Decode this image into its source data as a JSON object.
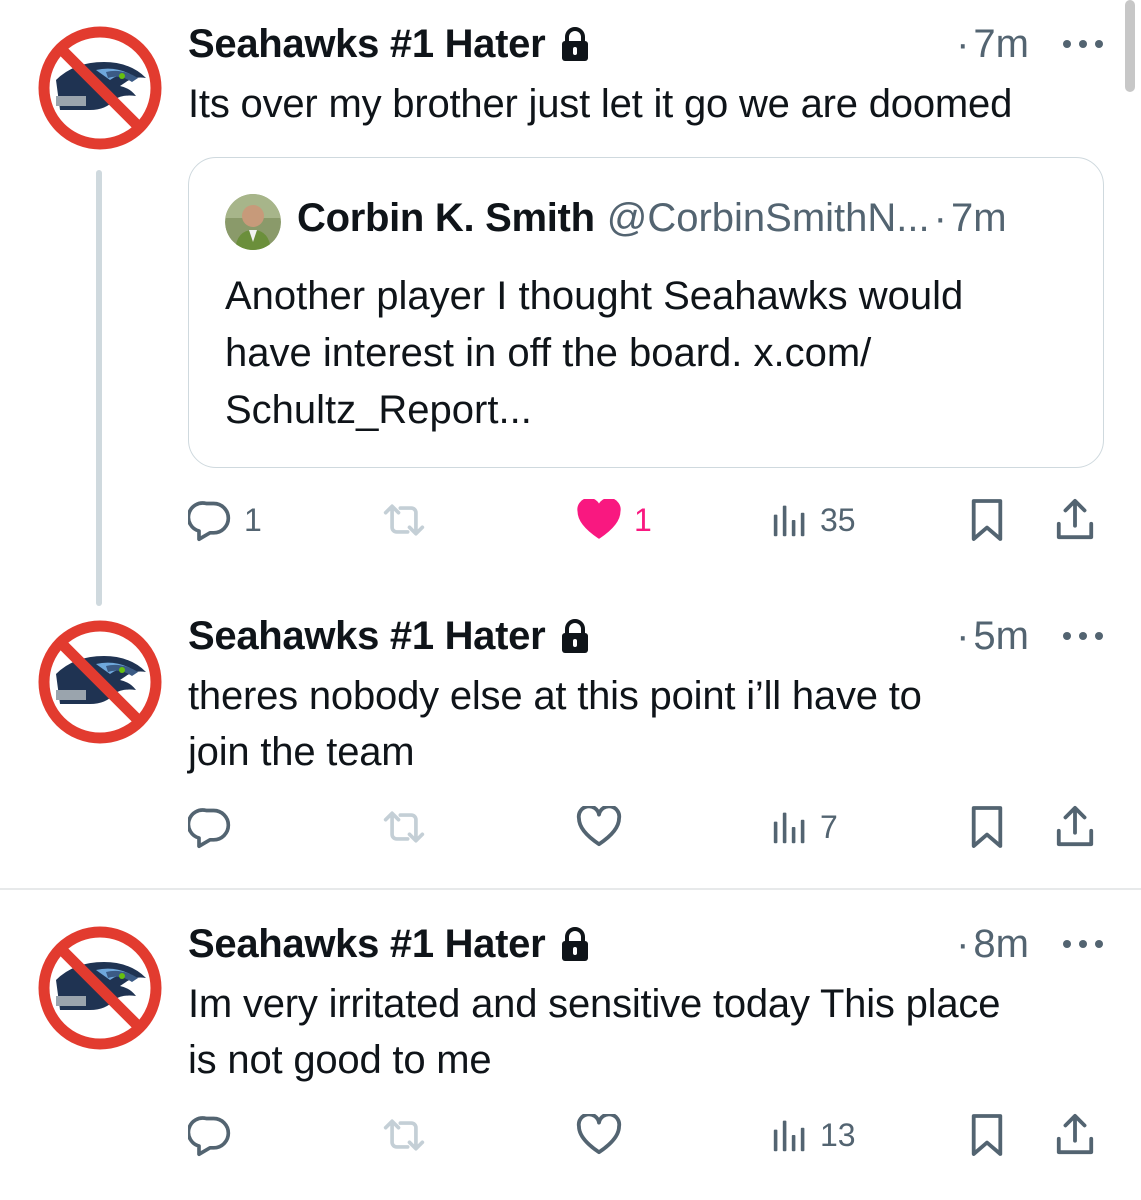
{
  "colors": {
    "like_active": "#f91880",
    "secondary_text": "#536471",
    "primary_text": "#0f1419",
    "border": "#cfd9de"
  },
  "tweets": [
    {
      "author": "Seahawks #1 Hater",
      "time": "7m",
      "text": "Its over my brother just let it go we are doomed",
      "quote": {
        "author": "Corbin K. Smith",
        "handle": "@CorbinSmithN...",
        "time": "7m",
        "text": "Another player I thought Seahawks would\nhave interest in off the board. x.com/\nSchultz_Report..."
      },
      "actions": {
        "replies": "1",
        "retweets": "",
        "likes": "1",
        "liked": true,
        "views": "35"
      }
    },
    {
      "author": "Seahawks #1 Hater",
      "time": "5m",
      "text": "theres nobody else at this point i’ll have to\njoin the team",
      "actions": {
        "replies": "",
        "retweets": "",
        "likes": "",
        "liked": false,
        "views": "7"
      }
    },
    {
      "author": "Seahawks #1 Hater",
      "time": "8m",
      "text": "Im very irritated and sensitive today This place\nis not good to me",
      "actions": {
        "replies": "",
        "retweets": "",
        "likes": "",
        "liked": false,
        "views": "13"
      }
    }
  ],
  "icons": {
    "avatar": "no-seahawks-icon",
    "lock": "lock-icon",
    "more": "more-icon",
    "reply": "reply-icon",
    "retweet": "retweet-icon",
    "like": "heart-icon",
    "views": "views-icon",
    "bookmark": "bookmark-icon",
    "share": "share-icon"
  }
}
